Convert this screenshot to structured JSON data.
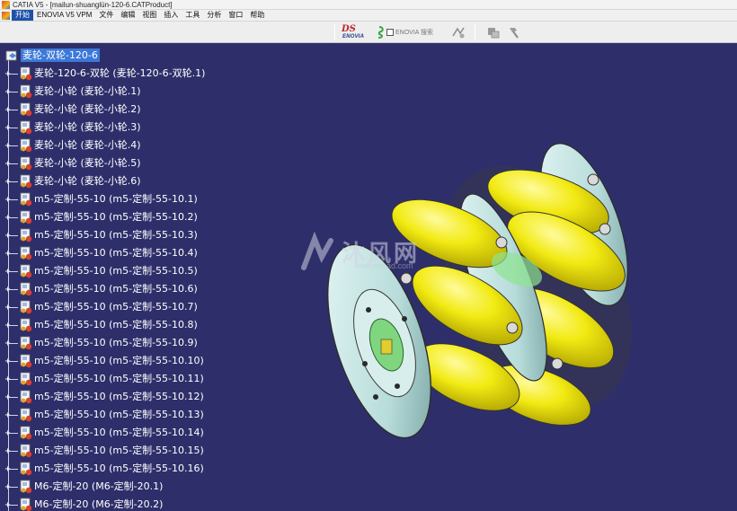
{
  "window": {
    "title": "CATIA V5 - [mailun-shuanglün-120-6.CATProduct]"
  },
  "menubar": {
    "items": [
      "开始",
      "ENOVIA V5 VPM",
      "文件",
      "编辑",
      "视图",
      "插入",
      "工具",
      "分析",
      "窗口",
      "帮助"
    ]
  },
  "toolbar": {
    "ds_logo": "DS",
    "enovia_logo": "ENOVIA",
    "search_label": "ENOVIA 搜索"
  },
  "tree": {
    "root": "麦轮-双轮-120-6",
    "items": [
      "麦轮-120-6-双轮 (麦轮-120-6-双轮.1)",
      "麦轮-小轮 (麦轮-小轮.1)",
      "麦轮-小轮 (麦轮-小轮.2)",
      "麦轮-小轮 (麦轮-小轮.3)",
      "麦轮-小轮 (麦轮-小轮.4)",
      "麦轮-小轮 (麦轮-小轮.5)",
      "麦轮-小轮 (麦轮-小轮.6)",
      "m5-定制-55-10 (m5-定制-55-10.1)",
      "m5-定制-55-10 (m5-定制-55-10.2)",
      "m5-定制-55-10 (m5-定制-55-10.3)",
      "m5-定制-55-10 (m5-定制-55-10.4)",
      "m5-定制-55-10 (m5-定制-55-10.5)",
      "m5-定制-55-10 (m5-定制-55-10.6)",
      "m5-定制-55-10 (m5-定制-55-10.7)",
      "m5-定制-55-10 (m5-定制-55-10.8)",
      "m5-定制-55-10 (m5-定制-55-10.9)",
      "m5-定制-55-10 (m5-定制-55-10.10)",
      "m5-定制-55-10 (m5-定制-55-10.11)",
      "m5-定制-55-10 (m5-定制-55-10.12)",
      "m5-定制-55-10 (m5-定制-55-10.13)",
      "m5-定制-55-10 (m5-定制-55-10.14)",
      "m5-定制-55-10 (m5-定制-55-10.15)",
      "m5-定制-55-10 (m5-定制-55-10.16)",
      "M6-定制-20 (M6-定制-20.1)",
      "M6-定制-20 (M6-定制-20.2)"
    ]
  },
  "watermark": {
    "text": "沐风网",
    "url": "www.mfcad.com"
  },
  "colors": {
    "background": "#2e2f6a",
    "selection": "#3b78d8",
    "roller_yellow": "#f2ea12",
    "hub_cyan": "#c8e6e4"
  }
}
